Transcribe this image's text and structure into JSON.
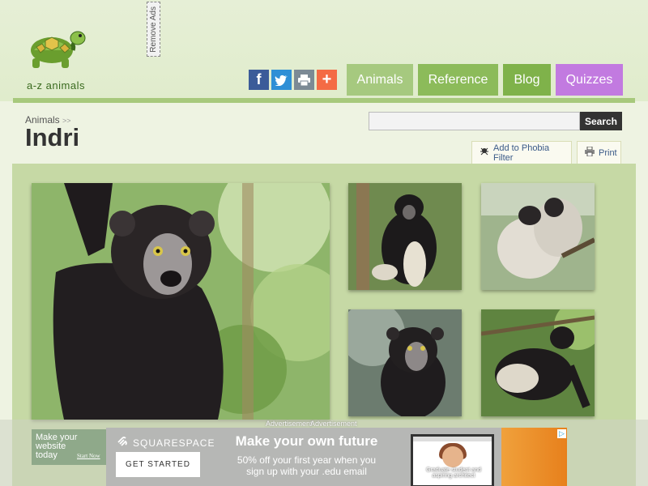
{
  "brand": {
    "name": "a-z animals",
    "logo_icon": "turtle-logo-icon"
  },
  "remove_ads": "Remove Ads",
  "social": [
    {
      "name": "facebook-icon",
      "glyph": "f",
      "color": "#3b5b99"
    },
    {
      "name": "twitter-icon",
      "glyph": "🐦",
      "color": "#2f8fd6"
    },
    {
      "name": "print-icon",
      "glyph": "⎙",
      "color": "#7c8a95"
    },
    {
      "name": "plus-icon",
      "glyph": "+",
      "color": "#f46b45"
    }
  ],
  "nav": {
    "animals": "Animals",
    "reference": "Reference",
    "blog": "Blog",
    "quizzes": "Quizzes"
  },
  "breadcrumb": {
    "root": "Animals",
    "sep": ">>"
  },
  "page_title": "Indri",
  "search": {
    "value": "",
    "button": "Search"
  },
  "actions": {
    "phobia": "Add to Phobia Filter",
    "print": "Print"
  },
  "ads": {
    "label1": "Advertisement",
    "label2": "Advertisement",
    "small_ad": {
      "line1": "Make your",
      "line2": "website",
      "line3": "today",
      "link": "Start Now"
    },
    "banner": {
      "brand": "SQUARESPACE",
      "cta": "GET STARTED",
      "headline": "Make your own future",
      "sub1": "50% off your first year when you",
      "sub2": "sign up with your .edu email",
      "caption": "Graduate student and aspiring architect"
    }
  }
}
